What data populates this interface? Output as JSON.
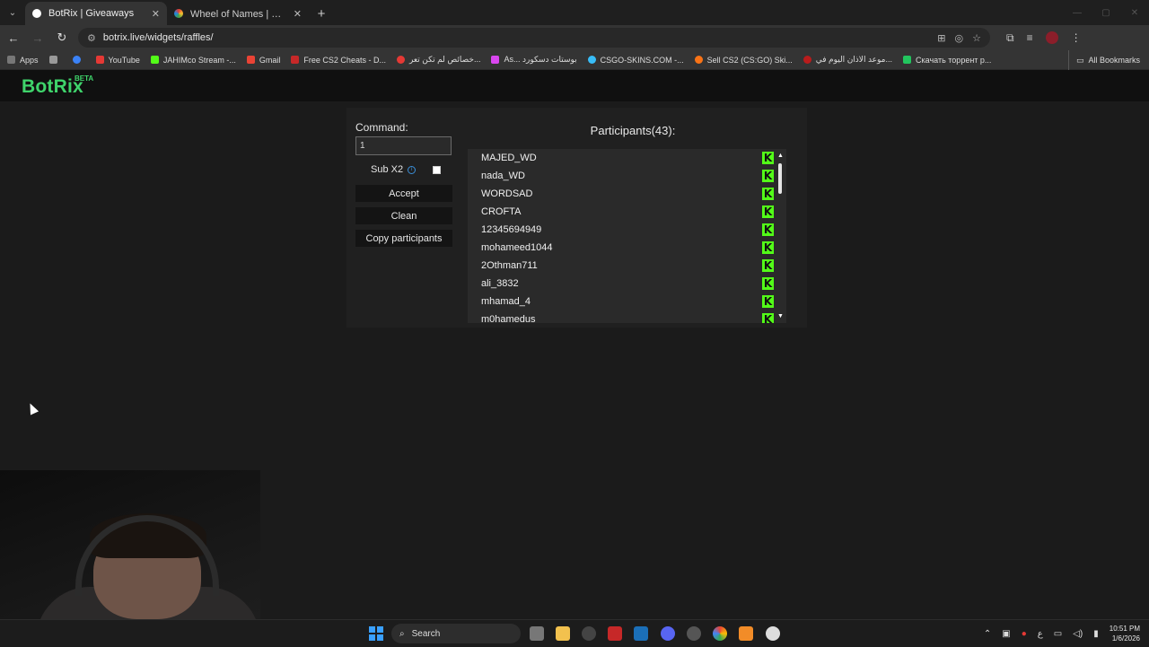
{
  "browser": {
    "tabs": [
      {
        "title": "BotRix | Giveaways",
        "active": true,
        "favicon_color": "#ffffff"
      },
      {
        "title": "Wheel of Names | اسم العشوائي",
        "active": false,
        "favicon_color": "#3b7be8"
      }
    ],
    "address": "botrix.live/widgets/raffles/",
    "bookmarks": [
      {
        "label": "Apps",
        "color": "#6a6a6a"
      },
      {
        "label": "",
        "color": "#3b82f6"
      },
      {
        "label": "YouTube",
        "color": "#e53935"
      },
      {
        "label": "JAHIMco Stream -...",
        "color": "#53fc18"
      },
      {
        "label": "Gmail",
        "color": "#ea4335"
      },
      {
        "label": "Free CS2 Cheats - D...",
        "color": "#c62828"
      },
      {
        "label": "خصائص لم تكن تعر...",
        "color": "#e53935"
      },
      {
        "label": "As... بوستات دسكورد",
        "color": "#d946ef"
      },
      {
        "label": "CSGO-SKINS.COM -...",
        "color": "#38bdf8"
      },
      {
        "label": "Sell CS2 (CS:GO) Ski...",
        "color": "#f97316"
      },
      {
        "label": "موعد الاذان اليوم في...",
        "color": "#b91c1c"
      },
      {
        "label": "Скачать торрент р...",
        "color": "#22c55e"
      }
    ],
    "all_bookmarks": "All Bookmarks"
  },
  "app": {
    "logo": "BotRix",
    "badge": "BETA"
  },
  "raffle": {
    "command_label": "Command:",
    "command_value": "1",
    "sub_x2_label": "Sub X2",
    "sub_x2_checked": false,
    "accept_label": "Accept",
    "clean_label": "Clean",
    "copy_label": "Copy participants",
    "participants_title": "Participants(43):",
    "participants": [
      "MAJED_WD",
      "nada_WD",
      "WORDSAD",
      "CROFTA",
      "12345694949",
      "mohameed1044",
      "2Othman711",
      "ali_3832",
      "mhamad_4",
      "m0hamedus"
    ],
    "platform_icon": "kick-icon",
    "platform_color": "#53fc18"
  },
  "taskbar": {
    "search_label": "Search",
    "time": "10:51 PM",
    "date": "1/6/2026",
    "lang": "ع"
  }
}
